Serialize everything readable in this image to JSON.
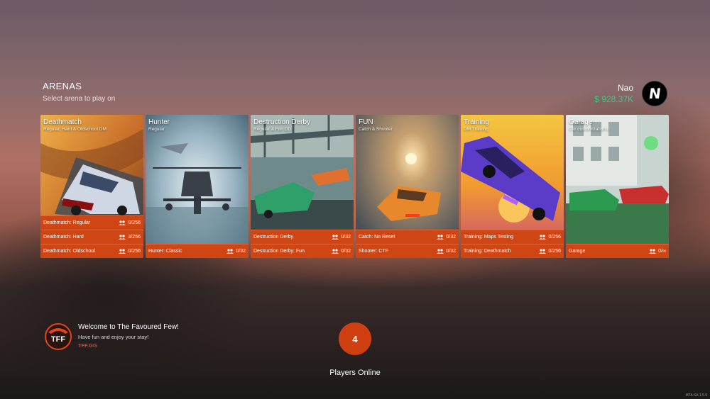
{
  "header": {
    "title": "ARENAS",
    "subtitle": "Select arena to play on"
  },
  "user": {
    "name": "Nao",
    "money": "$ 928.37K",
    "avatar_letter": "N"
  },
  "arenas": [
    {
      "title": "Deathmatch",
      "subtitle": "Regular, Hard & Oldschool DM",
      "modes": [
        {
          "name": "Deathmatch: Regular",
          "count": "0/256"
        },
        {
          "name": "Deathmatch: Hard",
          "count": "3/256"
        },
        {
          "name": "Deathmatch: Oldschool",
          "count": "0/256"
        }
      ]
    },
    {
      "title": "Hunter",
      "subtitle": "Regular",
      "modes": [
        {
          "name": "Hunter: Classic",
          "count": "0/32"
        }
      ]
    },
    {
      "title": "Destruction Derby",
      "subtitle": "Regular & Fun DD",
      "modes": [
        {
          "name": "Destruction Derby",
          "count": "0/32"
        },
        {
          "name": "Destruction Derby: Fun",
          "count": "0/32"
        }
      ]
    },
    {
      "title": "FUN",
      "subtitle": "Catch & Shooter",
      "modes": [
        {
          "name": "Catch: No Reset",
          "count": "0/32"
        },
        {
          "name": "Shooter: CTF",
          "count": "0/32"
        }
      ]
    },
    {
      "title": "Training",
      "subtitle": "DM Training",
      "modes": [
        {
          "name": "Training: Maps Testing",
          "count": "0/256"
        },
        {
          "name": "Training: Deathmatch",
          "count": "0/256"
        }
      ]
    },
    {
      "title": "Garage",
      "subtitle": "Car customizations",
      "modes": [
        {
          "name": "Garage",
          "count": "0/∞"
        }
      ]
    }
  ],
  "welcome": {
    "title": "Welcome to The Favoured Few!",
    "text": "Have fun and enjoy your stay!",
    "link": "TFF.GG",
    "logo_text": "TFF"
  },
  "online": {
    "count": "4",
    "label": "Players Online"
  },
  "version": "MTA:SA 1.5.9",
  "colors": {
    "accent": "#cf4614",
    "money": "#3fc58a",
    "link": "#e4451a"
  },
  "icons": {
    "players": "users-icon"
  }
}
